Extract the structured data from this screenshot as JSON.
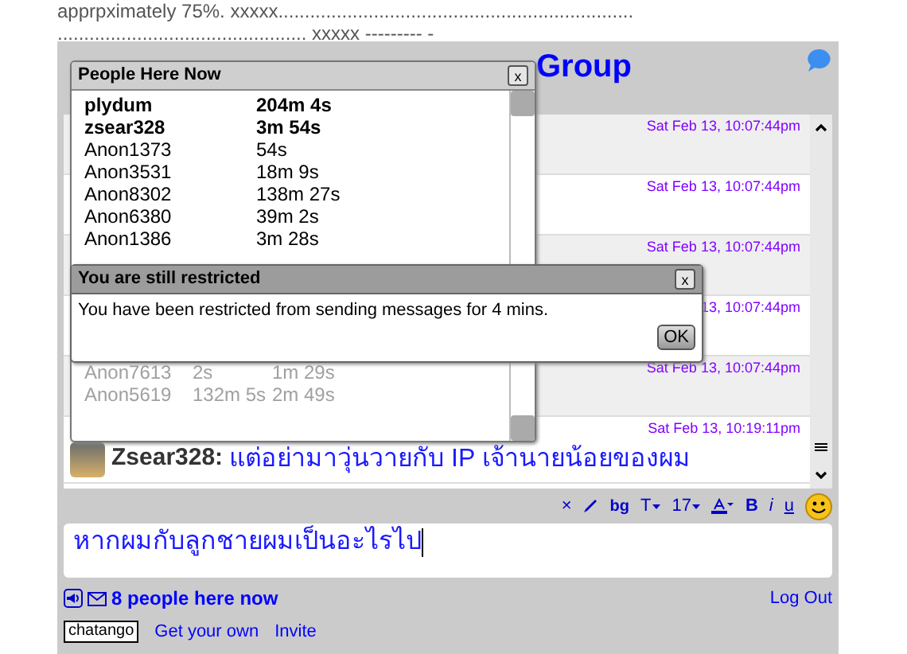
{
  "page_text": [
    "apprpximately 75%. xxxxx...................................................................",
    "............................................... xxxxx --------- -"
  ],
  "chat": {
    "title_visible": "Group",
    "messages": [
      {
        "time": "Sat Feb 13, 10:07:44pm"
      },
      {
        "time": "Sat Feb 13, 10:07:44pm"
      },
      {
        "time": "Sat Feb 13, 10:07:44pm"
      },
      {
        "time": "13, 10:07:44pm"
      },
      {
        "time": "Sat Feb 13, 10:07:44pm"
      },
      {
        "time": "Sat Feb 13, 10:19:11pm",
        "author": "Zsear328:",
        "text": "แต่อย่ามาวุ่นวายกับ IP เจ้านายน้อยของผม"
      }
    ],
    "toolbar": [
      "×",
      "bg",
      "T",
      "17",
      "B",
      "i",
      "u"
    ],
    "input_value": "หากผมกับลูกชายผมเป็นอะไรไป",
    "people_count": "8 people here now",
    "logout": "Log Out",
    "logo": "chatango",
    "links": [
      "Get your own",
      "Invite"
    ]
  },
  "people_popup": {
    "title": "People Here Now",
    "close": "x",
    "people": [
      {
        "name": "plydum",
        "kind": "user",
        "times": [
          "204m 4s"
        ]
      },
      {
        "name": "zsear328",
        "kind": "user",
        "times": [
          "3m 54s"
        ]
      },
      {
        "name": "Anon1373",
        "kind": "anon",
        "times": [
          "54s"
        ]
      },
      {
        "name": "Anon3531",
        "kind": "anon",
        "times": [
          "18m 9s"
        ]
      },
      {
        "name": "Anon8302",
        "kind": "anon",
        "times": [
          "138m 27s"
        ]
      },
      {
        "name": "Anon6380",
        "kind": "anon",
        "times": [
          "39m 2s"
        ]
      },
      {
        "name": "Anon1386",
        "kind": "anon",
        "times": [
          "3m 28s"
        ]
      },
      {
        "name": "Anon7613",
        "kind": "left",
        "times": [
          "2s",
          "1m 29s"
        ]
      },
      {
        "name": "Anon5619",
        "kind": "left",
        "times": [
          "132m 5s",
          "2m 49s"
        ]
      }
    ]
  },
  "restricted_dialog": {
    "title": "You are still restricted",
    "close": "x",
    "message": "You have been restricted from sending messages for 4 mins.",
    "ok": "OK"
  }
}
